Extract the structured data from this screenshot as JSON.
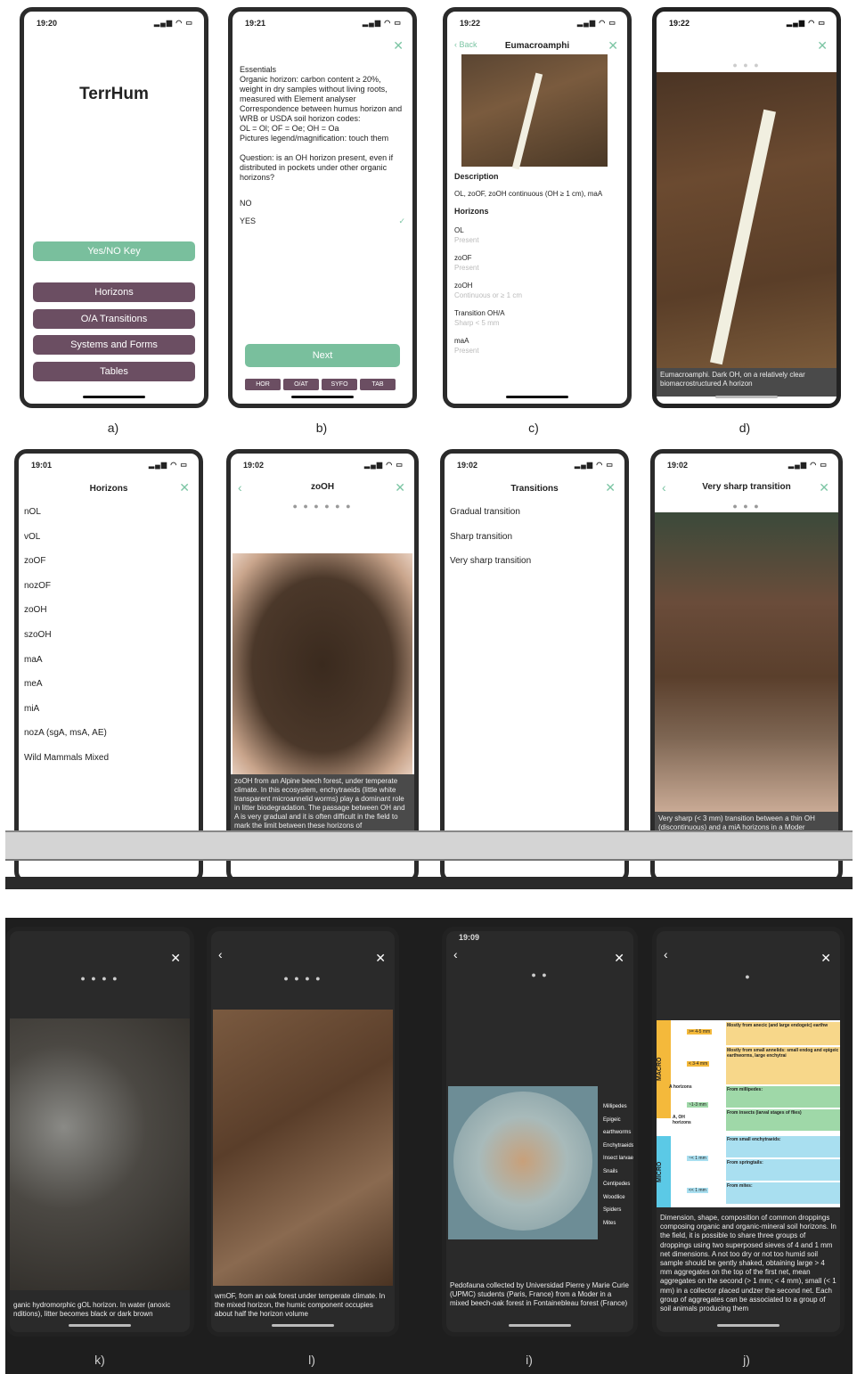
{
  "phones": [
    {
      "time": "19:20",
      "title": "TerrHum",
      "buttons": {
        "key": "Yes/NO Key",
        "horizons": "Horizons",
        "transitions": "O/A Transitions",
        "systems": "Systems and Forms",
        "tables": "Tables"
      },
      "label": "a)"
    },
    {
      "time": "19:21",
      "text": [
        "Essentials",
        "Organic horizon: carbon content ≥ 20%, weight in dry samples without living roots, measured with Element analyser",
        "Correspondence between humus horizon and WRB or USDA soil horizon codes:",
        "OL = Ol; OF = Oe; OH = Oa",
        "Pictures legend/magnification: touch them",
        "",
        "Question: is an OH horizon present, even if distributed in pockets under other organic horizons?"
      ],
      "options": [
        "NO",
        "YES"
      ],
      "check": "✓",
      "next": "Next",
      "tabs": [
        "HOR",
        "O/AT",
        "SYFO",
        "TAB"
      ],
      "label": "b)"
    },
    {
      "time": "19:22",
      "back": "Back",
      "title": "Eumacroamphi",
      "desc_h": "Description",
      "desc": "OL, zoOF, zoOH continuous (OH ≥ 1 cm), maA",
      "hor_h": "Horizons",
      "hor": [
        {
          "n": "OL",
          "v": "Present"
        },
        {
          "n": "zoOF",
          "v": "Present"
        },
        {
          "n": "zoOH",
          "v": "Continuous or ≥ 1 cm"
        },
        {
          "n": "Transition OH/A",
          "v": "Sharp < 5 mm"
        },
        {
          "n": "maA",
          "v": "Present"
        }
      ],
      "label": "c)"
    },
    {
      "time": "19:22",
      "caption": "Eumacroamphi. Dark OH, on a relatively clear biomacrostructured A horizon",
      "label": "d)"
    },
    {
      "time": "19:01",
      "title": "Horizons",
      "items": [
        "nOL",
        "vOL",
        "zoOF",
        "nozOF",
        "zoOH",
        "szoOH",
        "maA",
        "meA",
        "miA",
        "nozA (sgA, msA, AE)",
        "Wild Mammals Mixed"
      ]
    },
    {
      "time": "19:02",
      "title": "zoOH",
      "caption": "zoOH from an Alpine beech forest, under temperate climate. In this ecosystem, enchytraeids (little white transparent microannelid worms) play a dominant role in litter biodegradation. The passage between OH and A is very gradual and it is often difficult in the field to mark the limit between these horizons of"
    },
    {
      "time": "19:02",
      "title": "Transitions",
      "items": [
        "Gradual transition",
        "Sharp transition",
        "Very sharp transition"
      ]
    },
    {
      "time": "19:02",
      "title": "Very sharp transition",
      "caption": "Very sharp (< 3 mm) transition between a thin OH (discontinuous) and a miA horizons in a Moder"
    },
    {
      "caption": "ganic hydromorphic gOL horizon. In water (anoxic nditions), litter becomes black or dark brown",
      "label": "k)"
    },
    {
      "caption": "wmOF, from an oak forest under temperate climate. In the mixed horizon, the humic component occupies about half the horizon volume",
      "label": "l)"
    },
    {
      "time": "19:09",
      "caption": "Pedofauna collected by Universidad Pierre y Marie Curie (UPMC) students (Paris, France) from a Moder in a mixed beech-oak forest in Fontainebleau forest (France)",
      "legend": [
        "Millipedes",
        "Epigeic earthworms",
        "Enchytraeids",
        "Insect larvae",
        "Snails",
        "Centipedes",
        "Woodlice",
        "Spiders",
        "Mites"
      ],
      "label": "i)"
    },
    {
      "caption": "Dimension, shape, composition of common droppings composing organic and organic-mineral soil horizons. In the field, it is possible to share three groups of droppings using two superposed sieves of 4 and 1 mm net dimensions. A not too dry or not too humid soil sample should be gently shaked, obtaining large > 4 mm aggregates on the top of the first net, mean aggregates on the second (> 1 mm; < 4 mm), small (< 1 mm) in a collector placed undzer the second net. Each group of aggregates can be associated to a group of soil animals producing them",
      "macro": "MACRO",
      "micro": "MICRO",
      "rows": [
        "Mostly from anecic (and large endogeic) earthw",
        "Mostly from small annelids: small endog and epigeic earthworms, large enchytrai",
        "From millipedes:",
        "From insects (larval stages of flies)",
        "From small enchytraeids:",
        "From springtails:",
        "From mites:"
      ],
      "sizes": [
        ">= 4-5 mm",
        "< 3-4 mm",
        "~1-3 mm",
        "~< 1 mm",
        "<< 1 mm"
      ],
      "ah": "A horizons",
      "oh": "A, OH horizons",
      "label": "j)"
    }
  ]
}
